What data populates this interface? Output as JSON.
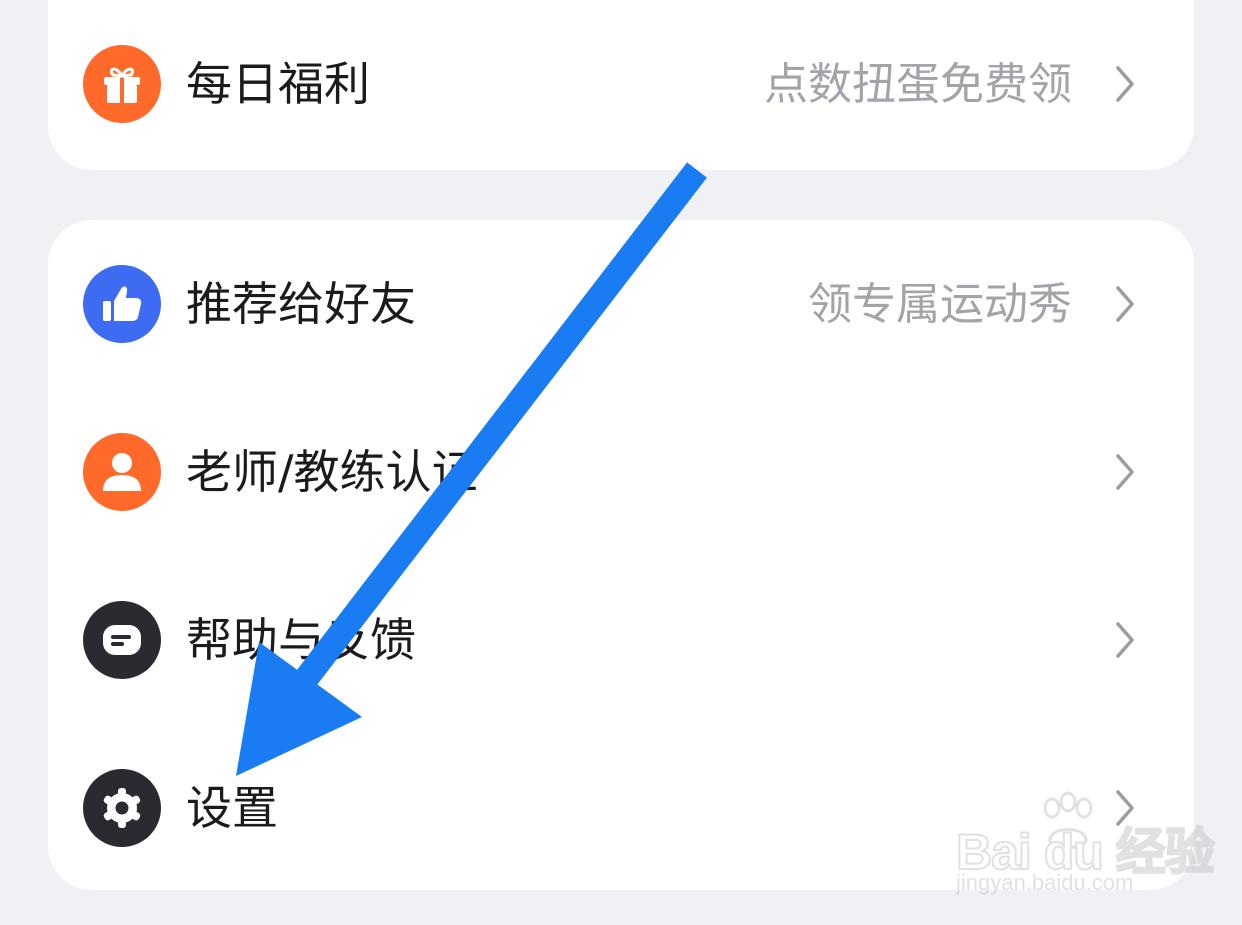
{
  "top_card": {
    "daily_bonus": {
      "label": "每日福利",
      "hint": "点数扭蛋免费领",
      "icon": "gift-icon",
      "icon_color": "#ff6a2b"
    }
  },
  "menu": {
    "items": [
      {
        "label": "推荐给好友",
        "hint": "领专属运动秀",
        "icon": "thumbs-up-icon",
        "icon_color": "#3d6bf2"
      },
      {
        "label": "老师/教练认证",
        "hint": "",
        "icon": "person-icon",
        "icon_color": "#ff6a2b"
      },
      {
        "label": "帮助与反馈",
        "hint": "",
        "icon": "message-icon",
        "icon_color": "#2a2b30"
      },
      {
        "label": "设置",
        "hint": "",
        "icon": "gear-icon",
        "icon_color": "#2a2b30"
      }
    ]
  },
  "annotation": {
    "color": "#1a7cf3"
  },
  "watermark": {
    "logo": "Bai du 经验",
    "url": "jingyan.baidu.com"
  }
}
